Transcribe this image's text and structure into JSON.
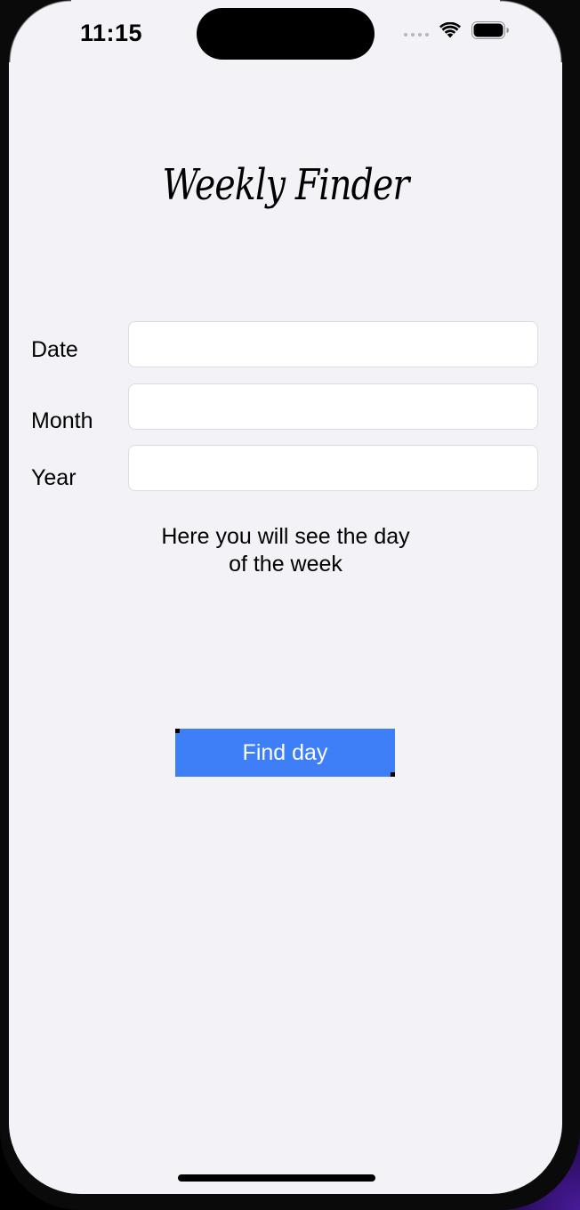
{
  "status_bar": {
    "time": "11:15",
    "wifi_icon": "wifi-icon",
    "battery_icon": "battery-icon"
  },
  "app": {
    "title": "Weekly Finder"
  },
  "form": {
    "date_label": "Date",
    "date_value": "",
    "month_label": "Month",
    "month_value": "",
    "year_label": "Year",
    "year_value": ""
  },
  "result": {
    "line1": "Here you will see the day",
    "line2": "of the week"
  },
  "actions": {
    "find_label": "Find day"
  },
  "colors": {
    "background": "#f2f2f7",
    "button": "#3e7ef7",
    "button_text": "#ffffff"
  }
}
